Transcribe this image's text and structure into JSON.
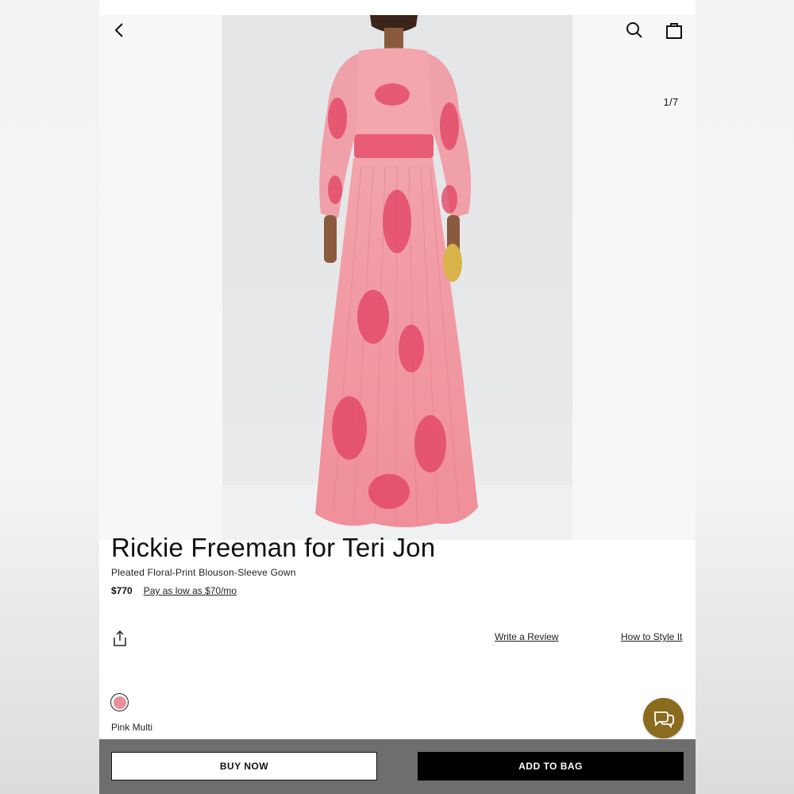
{
  "header": {
    "back_icon": "chevron-left-icon",
    "search_icon": "search-icon",
    "bag_icon": "shopping-bag-icon"
  },
  "gallery": {
    "counter": "1/7"
  },
  "product": {
    "brand": "Rickie Freeman for Teri Jon",
    "name": "Pleated Floral-Print Blouson-Sleeve Gown",
    "price": "$770",
    "financing": "Pay as low as $70/mo"
  },
  "actions": {
    "share_icon": "share-icon",
    "write_review": "Write a Review",
    "how_to_style": "How to Style It"
  },
  "color": {
    "label": "Pink Multi",
    "swatch_hex": "#e8909a"
  },
  "chat": {
    "icon": "chat-bubbles-icon",
    "color": "#8b6b1e"
  },
  "footer": {
    "buy_now": "BUY NOW",
    "add_to_bag": "ADD TO BAG"
  }
}
